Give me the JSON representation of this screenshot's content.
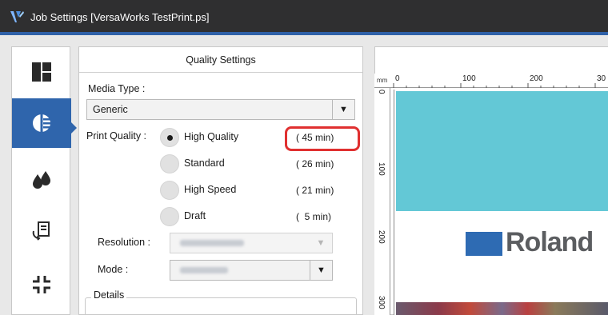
{
  "window": {
    "title": "Job Settings [VersaWorks TestPrint.ps]"
  },
  "sidebar": {
    "items": [
      {
        "icon": "layout-icon",
        "active": false
      },
      {
        "icon": "quality-icon",
        "active": true
      },
      {
        "icon": "ink-drops-icon",
        "active": false
      },
      {
        "icon": "color-management-icon",
        "active": false
      },
      {
        "icon": "cut-marks-icon",
        "active": false
      }
    ],
    "accent": "#2f65ac"
  },
  "quality_panel": {
    "header": "Quality Settings",
    "media_type_label": "Media Type :",
    "media_type_value": "Generic",
    "print_quality_label": "Print Quality :",
    "options": [
      {
        "label": "High Quality",
        "time": "( 45 min)",
        "selected": true
      },
      {
        "label": "Standard",
        "time": "( 26 min)",
        "selected": false
      },
      {
        "label": "High Speed",
        "time": "( 21 min)",
        "selected": false
      },
      {
        "label": "Draft",
        "time": "(  5 min)",
        "selected": false
      }
    ],
    "resolution_label": "Resolution :",
    "mode_label": "Mode :",
    "details_label": "Details",
    "highlight_color": "#e03030"
  },
  "preview": {
    "ruler_unit": "mm",
    "ruler_top_ticks": [
      "0",
      "100",
      "200",
      "30"
    ],
    "ruler_left_ticks": [
      "0",
      "100",
      "200",
      "300"
    ],
    "logo_text": "Roland",
    "logo_color": "#2e6bb3"
  }
}
